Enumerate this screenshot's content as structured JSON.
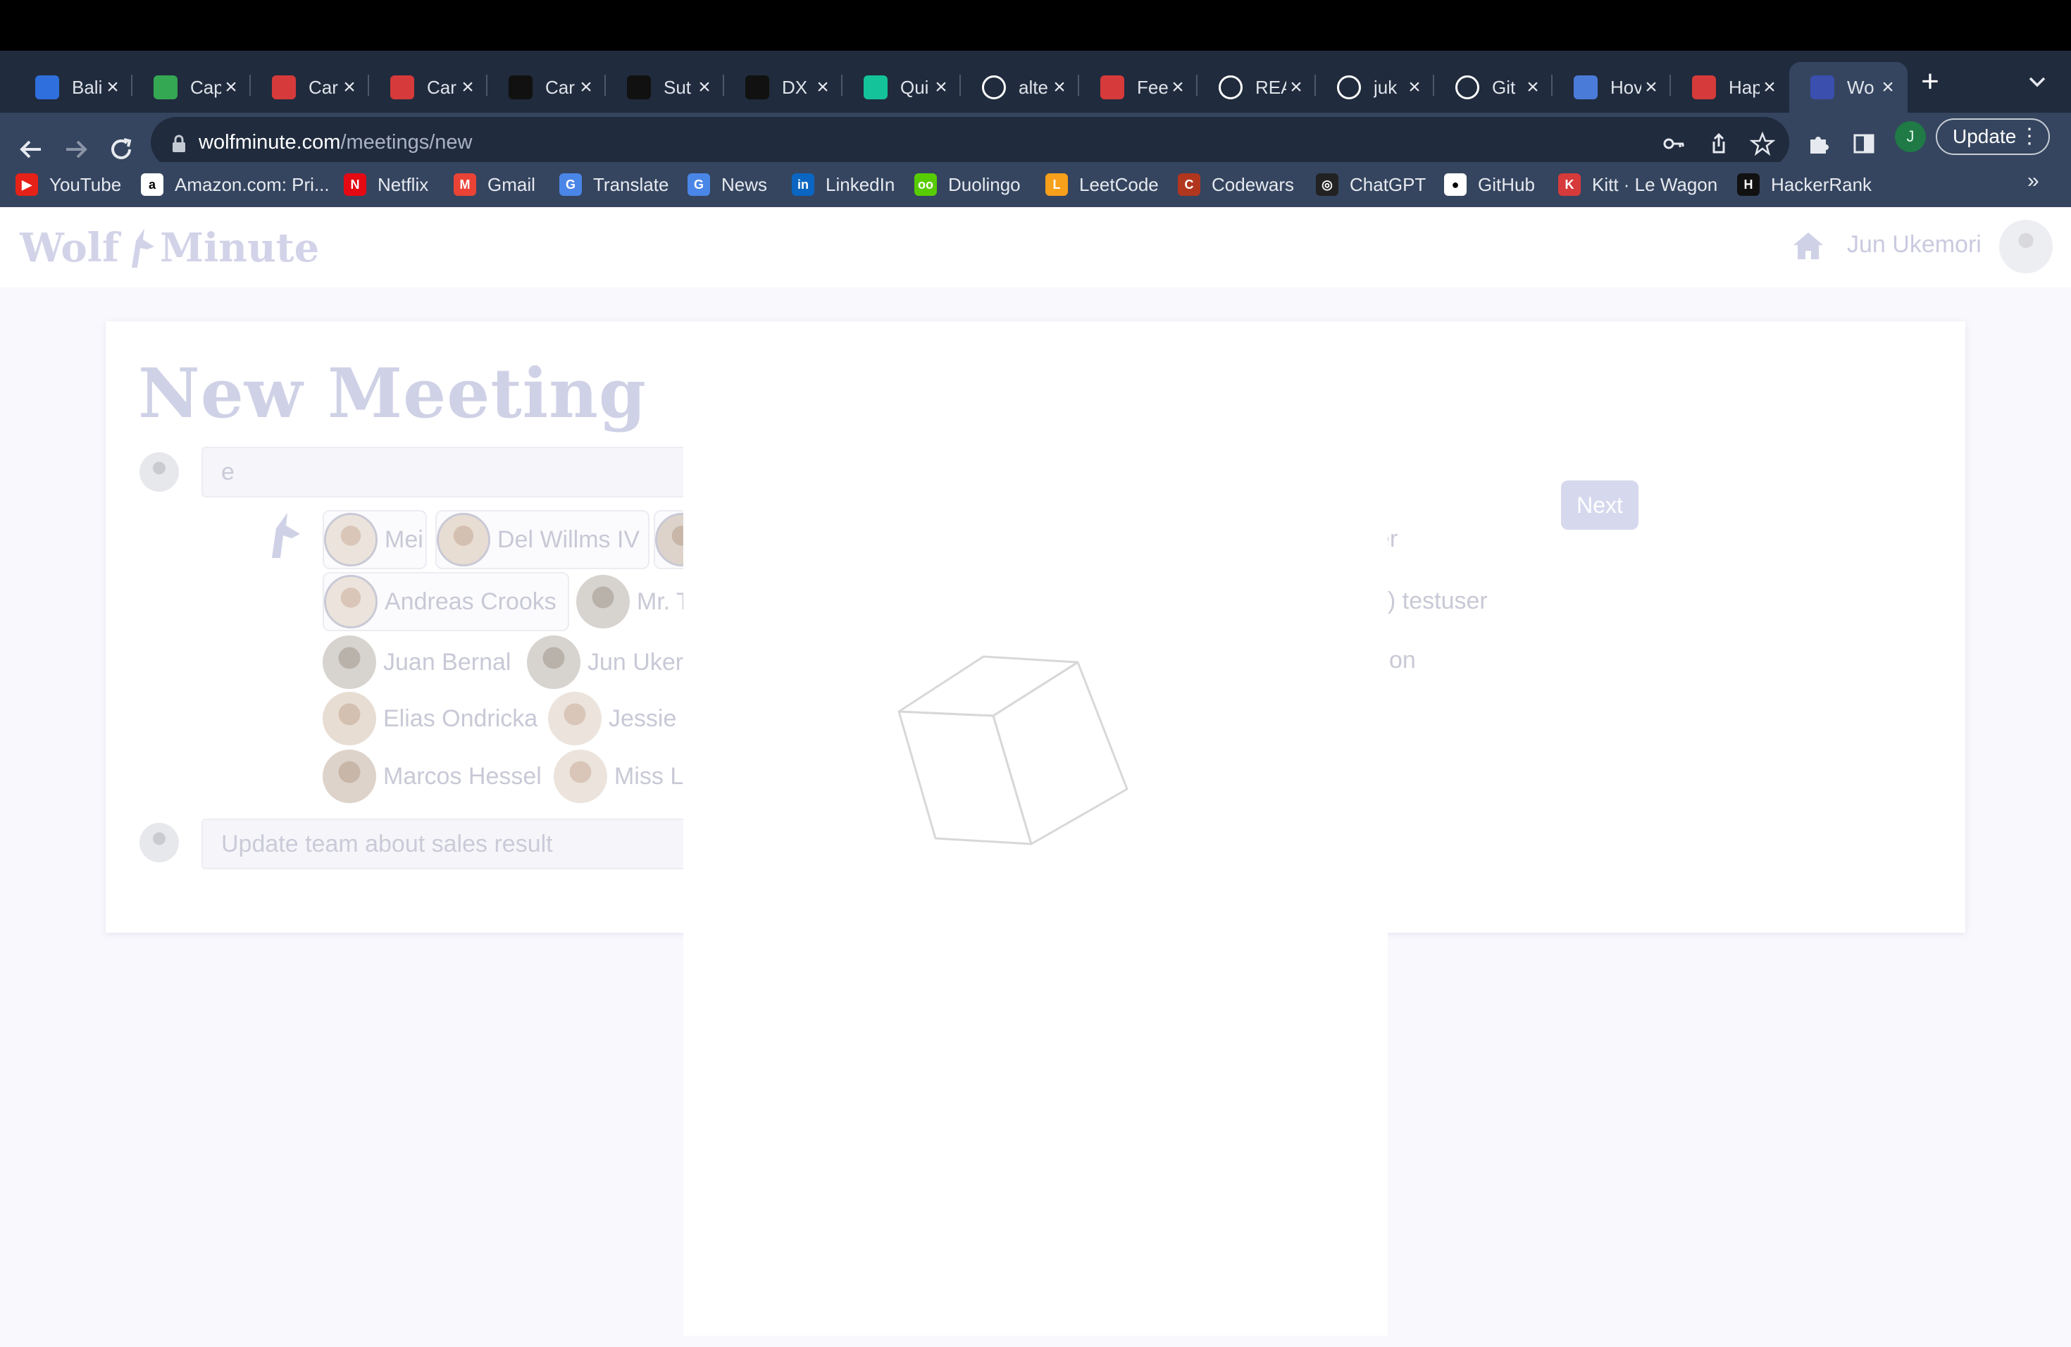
{
  "browser": {
    "tabs": [
      {
        "label": "Bali",
        "icon": "plane-icon",
        "color": "#2f6fdd"
      },
      {
        "label": "Cap",
        "icon": "maps-pin-icon",
        "color": "#34a853"
      },
      {
        "label": "Car",
        "icon": "lewagon-icon",
        "color": "#d63a3a"
      },
      {
        "label": "Car",
        "icon": "lewagon-icon",
        "color": "#d63a3a"
      },
      {
        "label": "Car",
        "icon": "notion-icon",
        "color": "#111111"
      },
      {
        "label": "Sut",
        "icon": "site-icon",
        "color": "#111111"
      },
      {
        "label": "DX",
        "icon": "site-icon",
        "color": "#111111"
      },
      {
        "label": "Qui",
        "icon": "grammarly-icon",
        "color": "#15c39a"
      },
      {
        "label": "alte",
        "icon": "google-icon",
        "color": "#ffffff"
      },
      {
        "label": "Fee",
        "icon": "lewagon-icon",
        "color": "#d63a3a"
      },
      {
        "label": "REA",
        "icon": "github-icon",
        "color": "#ffffff"
      },
      {
        "label": "juk",
        "icon": "github-icon",
        "color": "#ffffff"
      },
      {
        "label": "Git",
        "icon": "github-icon",
        "color": "#ffffff"
      },
      {
        "label": "Hov",
        "icon": "m-icon",
        "color": "#4b7bd9"
      },
      {
        "label": "Hap",
        "icon": "heart-icon",
        "color": "#d63a3a"
      },
      {
        "label": "Wo",
        "icon": "wolf-icon",
        "color": "#3b4fae"
      }
    ],
    "url_host": "wolfminute.com",
    "url_path": "/meetings/new",
    "update_label": "Update",
    "profile_initial": "J",
    "bookmarks": [
      {
        "label": "YouTube",
        "icon": "youtube-icon",
        "color": "#e62117",
        "glyph": "▶"
      },
      {
        "label": "Amazon.com: Pri...",
        "icon": "amazon-icon",
        "color": "#ffffff",
        "glyph": "a"
      },
      {
        "label": "Netflix",
        "icon": "netflix-icon",
        "color": "#e50914",
        "glyph": "N"
      },
      {
        "label": "Gmail",
        "icon": "gmail-icon",
        "color": "#ea4335",
        "glyph": "M"
      },
      {
        "label": "Translate",
        "icon": "translate-icon",
        "color": "#4a86e8",
        "glyph": "G"
      },
      {
        "label": "News",
        "icon": "news-icon",
        "color": "#4a86e8",
        "glyph": "G"
      },
      {
        "label": "LinkedIn",
        "icon": "linkedin-icon",
        "color": "#0a66c2",
        "glyph": "in"
      },
      {
        "label": "Duolingo",
        "icon": "duolingo-icon",
        "color": "#58cc02",
        "glyph": "oo"
      },
      {
        "label": "LeetCode",
        "icon": "leetcode-icon",
        "color": "#f89f1b",
        "glyph": "L"
      },
      {
        "label": "Codewars",
        "icon": "codewars-icon",
        "color": "#b1361e",
        "glyph": "C"
      },
      {
        "label": "ChatGPT",
        "icon": "chatgpt-icon",
        "color": "#222222",
        "glyph": "◎"
      },
      {
        "label": "GitHub",
        "icon": "github-icon",
        "color": "#ffffff",
        "glyph": "●"
      },
      {
        "label": "Kitt · Le Wagon",
        "icon": "lewagon-icon",
        "color": "#d63a3a",
        "glyph": "K"
      },
      {
        "label": "HackerRank",
        "icon": "hackerrank-icon",
        "color": "#111111",
        "glyph": "H"
      }
    ],
    "bookmarks_more": "»"
  },
  "app": {
    "logo_left": "Wolf",
    "logo_right": "Minute",
    "user_name": "Jun Ukemori"
  },
  "form": {
    "title": "New Meeting",
    "attendee_input_value": "e",
    "next_label": "Next",
    "agenda_placeholder": "Update team about sales result",
    "people_row1": [
      "Mei",
      "Del Willms IV"
    ],
    "people_row2": [
      "Andreas Crooks",
      "Mr. T"
    ],
    "people_row3": [
      "Juan Bernal",
      "Jun Uker"
    ],
    "people_row4": [
      "Elias Ondricka",
      "Jessie"
    ],
    "people_row5": [
      "Marcos Hessel",
      "Miss L"
    ],
    "ghost_right_1": "cker",
    "ghost_right_2": ") testuser",
    "ghost_right_3": "on"
  }
}
